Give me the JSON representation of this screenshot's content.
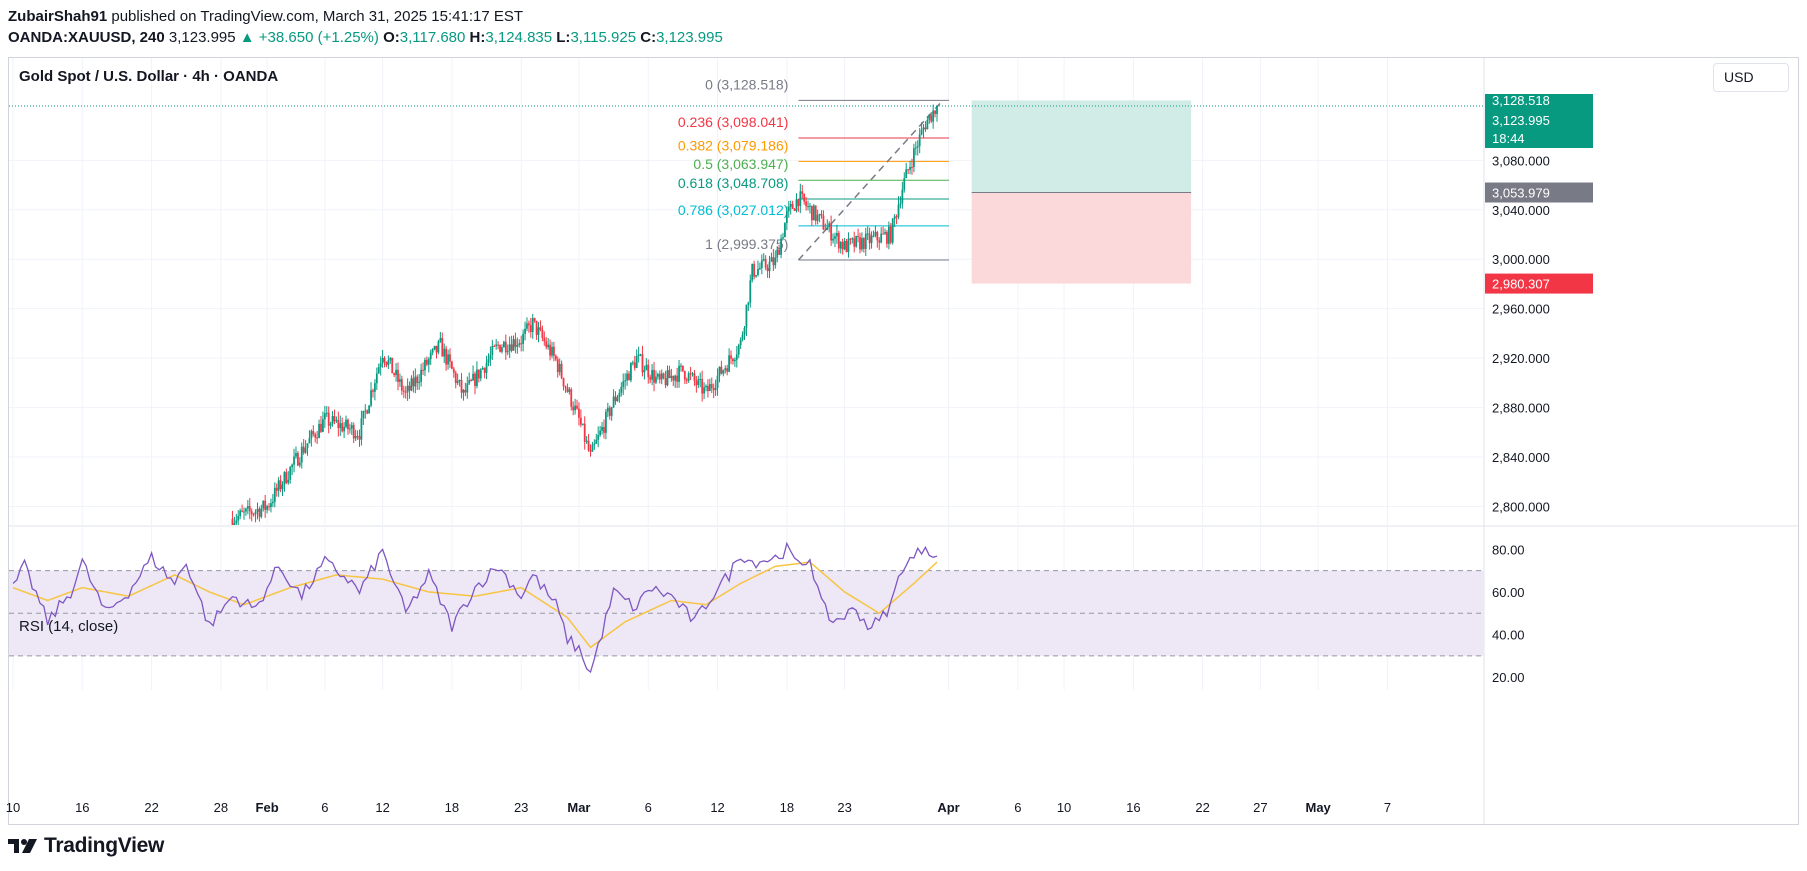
{
  "header": {
    "author": "ZubairShah91",
    "published_text": "published on TradingView.com, March 31, 2025 15:41:17 EST",
    "symbol": "OANDA:XAUUSD, 240",
    "price": "3,123.995",
    "change": "▲ +38.650 (+1.25%)",
    "o_label": "O:",
    "o_value": "3,117.680",
    "h_label": "H:",
    "h_value": "3,124.835",
    "l_label": "L:",
    "l_value": "3,115.925",
    "c_label": "C:",
    "c_value": "3,123.995"
  },
  "chart_title": "Gold Spot / U.S. Dollar · 4h · OANDA",
  "currency_button": "USD",
  "rsi_title": "RSI (14, close)",
  "brand": "TradingView",
  "colors": {
    "up": "#089981",
    "down": "#f23645",
    "rsi_line": "#7e57c2",
    "rsi_ma": "#f7c541",
    "rsi_band": "#ede7f6",
    "target_zone": "#d1ece6",
    "stop_zone": "#fbd9db"
  },
  "chart_data": [
    {
      "type": "candlestick",
      "title": "Gold Spot / U.S. Dollar · 4h · OANDA",
      "ylim": [
        2785,
        3145
      ],
      "y_ticks": [
        "3,080.000",
        "3,040.000",
        "3,000.000",
        "2,960.000",
        "2,920.000",
        "2,880.000",
        "2,840.000",
        "2,800.000"
      ],
      "y_tick_values": [
        3080,
        3040,
        3000,
        2960,
        2920,
        2880,
        2840,
        2800
      ],
      "x_ticks": [
        "10",
        "16",
        "22",
        "28",
        "Feb",
        "6",
        "12",
        "18",
        "23",
        "Mar",
        "6",
        "12",
        "18",
        "23",
        "Apr",
        "6",
        "10",
        "16",
        "22",
        "27",
        "May",
        "7"
      ],
      "x_tick_bold": [
        "Feb",
        "Mar",
        "Apr",
        "May"
      ],
      "close_anchors": [
        {
          "date": "2025-01-29",
          "close": 2790
        },
        {
          "date": "2025-02-01",
          "close": 2800
        },
        {
          "date": "2025-02-04",
          "close": 2845
        },
        {
          "date": "2025-02-06",
          "close": 2870
        },
        {
          "date": "2025-02-09",
          "close": 2860
        },
        {
          "date": "2025-02-11",
          "close": 2925
        },
        {
          "date": "2025-02-13",
          "close": 2890
        },
        {
          "date": "2025-02-15",
          "close": 2918
        },
        {
          "date": "2025-02-16",
          "close": 2930
        },
        {
          "date": "2025-02-18",
          "close": 2890
        },
        {
          "date": "2025-02-21",
          "close": 2930
        },
        {
          "date": "2025-02-23",
          "close": 2935
        },
        {
          "date": "2025-02-24",
          "close": 2948
        },
        {
          "date": "2025-02-26",
          "close": 2918
        },
        {
          "date": "2025-02-28",
          "close": 2870
        },
        {
          "date": "2025-03-01",
          "close": 2840
        },
        {
          "date": "2025-03-03",
          "close": 2885
        },
        {
          "date": "2025-03-05",
          "close": 2920
        },
        {
          "date": "2025-03-07",
          "close": 2900
        },
        {
          "date": "2025-03-09",
          "close": 2910
        },
        {
          "date": "2025-03-11",
          "close": 2892
        },
        {
          "date": "2025-03-13",
          "close": 2918
        },
        {
          "date": "2025-03-14",
          "close": 2932
        },
        {
          "date": "2025-03-15",
          "close": 2990
        },
        {
          "date": "2025-03-17",
          "close": 2998
        },
        {
          "date": "2025-03-18",
          "close": 3035
        },
        {
          "date": "2025-03-19",
          "close": 3050
        },
        {
          "date": "2025-03-21",
          "close": 3030
        },
        {
          "date": "2025-03-23",
          "close": 3010
        },
        {
          "date": "2025-03-25",
          "close": 3015
        },
        {
          "date": "2025-03-27",
          "close": 3020
        },
        {
          "date": "2025-03-28",
          "close": 3058
        },
        {
          "date": "2025-03-29",
          "close": 3086
        },
        {
          "date": "2025-03-30",
          "close": 3110
        },
        {
          "date": "2025-03-31",
          "close": 3124
        }
      ],
      "last_price": {
        "value": 3123.995,
        "label": "3,123.995",
        "countdown": "18:44",
        "high_label": "3,128.518"
      },
      "fibonacci": {
        "from": {
          "date": "2025-03-19",
          "price": 2999.375
        },
        "to": {
          "date": "2025-03-31",
          "price": 3128.518
        },
        "levels": [
          {
            "ratio": "0",
            "value": 3128.518,
            "label": "0 (3,128.518)",
            "color": "#787b86"
          },
          {
            "ratio": "0.236",
            "value": 3098.041,
            "label": "0.236 (3,098.041)",
            "color": "#f23645"
          },
          {
            "ratio": "0.382",
            "value": 3079.186,
            "label": "0.382 (3,079.186)",
            "color": "#ff9800"
          },
          {
            "ratio": "0.5",
            "value": 3063.947,
            "label": "0.5 (3,063.947)",
            "color": "#4caf50"
          },
          {
            "ratio": "0.618",
            "value": 3048.708,
            "label": "0.618 (3,048.708)",
            "color": "#089981"
          },
          {
            "ratio": "0.786",
            "value": 3027.012,
            "label": "0.786 (3,027.012)",
            "color": "#00bcd4"
          },
          {
            "ratio": "1",
            "value": 2999.375,
            "label": "1 (2,999.375)",
            "color": "#787b86"
          }
        ]
      },
      "position_tool": {
        "start_date": "2025-04-03",
        "end_date": "2025-04-22",
        "target": 3128.518,
        "entry": 3053.979,
        "stop": 2980.307,
        "entry_label": "3,053.979",
        "stop_label": "2,980.307"
      }
    },
    {
      "type": "line",
      "title": "RSI (14, close)",
      "ylim": [
        14,
        90
      ],
      "y_ticks": [
        "80.00",
        "60.00",
        "40.00",
        "20.00"
      ],
      "y_tick_values": [
        80,
        60,
        40,
        20
      ],
      "bands": [
        70,
        50,
        30
      ],
      "series": [
        {
          "anchors": [
            {
              "date": "2025-01-10",
              "value": 62
            },
            {
              "date": "2025-01-11",
              "value": 72
            },
            {
              "date": "2025-01-13",
              "value": 46
            },
            {
              "date": "2025-01-15",
              "value": 60
            },
            {
              "date": "2025-01-16",
              "value": 74
            },
            {
              "date": "2025-01-18",
              "value": 50
            },
            {
              "date": "2025-01-20",
              "value": 60
            },
            {
              "date": "2025-01-22",
              "value": 76
            },
            {
              "date": "2025-01-24",
              "value": 64
            },
            {
              "date": "2025-01-25",
              "value": 74
            },
            {
              "date": "2025-01-27",
              "value": 44
            },
            {
              "date": "2025-01-29",
              "value": 58
            },
            {
              "date": "2025-01-31",
              "value": 52
            },
            {
              "date": "2025-02-02",
              "value": 72
            },
            {
              "date": "2025-02-04",
              "value": 58
            },
            {
              "date": "2025-02-06",
              "value": 74
            },
            {
              "date": "2025-02-08",
              "value": 66
            },
            {
              "date": "2025-02-09",
              "value": 60
            },
            {
              "date": "2025-02-11",
              "value": 79
            },
            {
              "date": "2025-02-13",
              "value": 50
            },
            {
              "date": "2025-02-15",
              "value": 68
            },
            {
              "date": "2025-02-17",
              "value": 44
            },
            {
              "date": "2025-02-19",
              "value": 62
            },
            {
              "date": "2025-02-21",
              "value": 72
            },
            {
              "date": "2025-02-23",
              "value": 58
            },
            {
              "date": "2025-02-24",
              "value": 68
            },
            {
              "date": "2025-02-26",
              "value": 54
            },
            {
              "date": "2025-02-27",
              "value": 38
            },
            {
              "date": "2025-02-28",
              "value": 33
            },
            {
              "date": "2025-03-01",
              "value": 22
            },
            {
              "date": "2025-03-03",
              "value": 60
            },
            {
              "date": "2025-03-05",
              "value": 52
            },
            {
              "date": "2025-03-06",
              "value": 62
            },
            {
              "date": "2025-03-08",
              "value": 58
            },
            {
              "date": "2025-03-10",
              "value": 46
            },
            {
              "date": "2025-03-12",
              "value": 62
            },
            {
              "date": "2025-03-13",
              "value": 68
            },
            {
              "date": "2025-03-14",
              "value": 78
            },
            {
              "date": "2025-03-15",
              "value": 74
            },
            {
              "date": "2025-03-17",
              "value": 76
            },
            {
              "date": "2025-03-18",
              "value": 80
            },
            {
              "date": "2025-03-19",
              "value": 72
            },
            {
              "date": "2025-03-20",
              "value": 76
            },
            {
              "date": "2025-03-21",
              "value": 54
            },
            {
              "date": "2025-03-22",
              "value": 46
            },
            {
              "date": "2025-03-24",
              "value": 52
            },
            {
              "date": "2025-03-25",
              "value": 44
            },
            {
              "date": "2025-03-26",
              "value": 46
            },
            {
              "date": "2025-03-27",
              "value": 54
            },
            {
              "date": "2025-03-28",
              "value": 72
            },
            {
              "date": "2025-03-29",
              "value": 76
            },
            {
              "date": "2025-03-30",
              "value": 82
            },
            {
              "date": "2025-03-31",
              "value": 76
            }
          ]
        },
        {
          "anchors": [
            {
              "date": "2025-01-10",
              "value": 62
            },
            {
              "date": "2025-01-13",
              "value": 56
            },
            {
              "date": "2025-01-16",
              "value": 62
            },
            {
              "date": "2025-01-20",
              "value": 58
            },
            {
              "date": "2025-01-24",
              "value": 68
            },
            {
              "date": "2025-01-27",
              "value": 60
            },
            {
              "date": "2025-01-30",
              "value": 54
            },
            {
              "date": "2025-02-03",
              "value": 62
            },
            {
              "date": "2025-02-07",
              "value": 68
            },
            {
              "date": "2025-02-11",
              "value": 66
            },
            {
              "date": "2025-02-15",
              "value": 60
            },
            {
              "date": "2025-02-19",
              "value": 58
            },
            {
              "date": "2025-02-23",
              "value": 62
            },
            {
              "date": "2025-02-27",
              "value": 48
            },
            {
              "date": "2025-03-01",
              "value": 34
            },
            {
              "date": "2025-03-04",
              "value": 46
            },
            {
              "date": "2025-03-08",
              "value": 56
            },
            {
              "date": "2025-03-11",
              "value": 54
            },
            {
              "date": "2025-03-14",
              "value": 64
            },
            {
              "date": "2025-03-17",
              "value": 72
            },
            {
              "date": "2025-03-20",
              "value": 74
            },
            {
              "date": "2025-03-23",
              "value": 60
            },
            {
              "date": "2025-03-26",
              "value": 50
            },
            {
              "date": "2025-03-29",
              "value": 64
            },
            {
              "date": "2025-03-31",
              "value": 74
            }
          ]
        }
      ]
    }
  ]
}
